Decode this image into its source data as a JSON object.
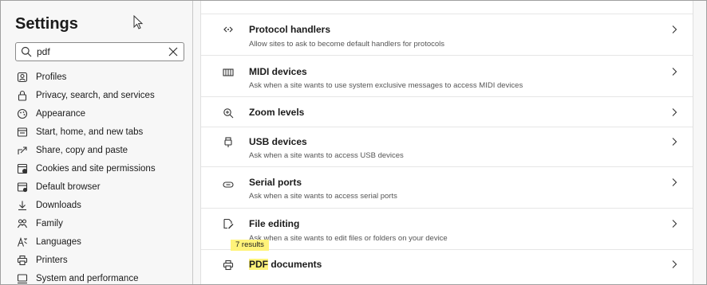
{
  "sidebar": {
    "title": "Settings",
    "search": {
      "value": "pdf",
      "placeholder": ""
    },
    "items": [
      {
        "label": "Profiles",
        "icon": "profile-icon"
      },
      {
        "label": "Privacy, search, and services",
        "icon": "lock-icon"
      },
      {
        "label": "Appearance",
        "icon": "appearance-icon"
      },
      {
        "label": "Start, home, and new tabs",
        "icon": "home-tabs-icon"
      },
      {
        "label": "Share, copy and paste",
        "icon": "share-icon"
      },
      {
        "label": "Cookies and site permissions",
        "icon": "cookies-icon"
      },
      {
        "label": "Default browser",
        "icon": "browser-icon"
      },
      {
        "label": "Downloads",
        "icon": "download-icon"
      },
      {
        "label": "Family",
        "icon": "family-icon"
      },
      {
        "label": "Languages",
        "icon": "languages-icon"
      },
      {
        "label": "Printers",
        "icon": "printer-icon"
      },
      {
        "label": "System and performance",
        "icon": "system-icon"
      }
    ]
  },
  "main": {
    "rows": [
      {
        "title": "Protocol handlers",
        "desc": "Allow sites to ask to become default handlers for protocols",
        "icon": "protocol-icon"
      },
      {
        "title": "MIDI devices",
        "desc": "Ask when a site wants to use system exclusive messages to access MIDI devices",
        "icon": "midi-icon"
      },
      {
        "title": "Zoom levels",
        "desc": "",
        "icon": "zoom-icon"
      },
      {
        "title": "USB devices",
        "desc": "Ask when a site wants to access USB devices",
        "icon": "usb-icon"
      },
      {
        "title": "Serial ports",
        "desc": "Ask when a site wants to access serial ports",
        "icon": "serial-icon"
      },
      {
        "title": "File editing",
        "desc": "Ask when a site wants to edit files or folders on your device",
        "icon": "file-edit-icon"
      },
      {
        "title_highlight": "PDF",
        "title_rest": " documents",
        "icon": "pdf-icon"
      }
    ],
    "results_tooltip": "7 results"
  },
  "colors": {
    "highlight": "#fff37a",
    "background": "#f7f7f7"
  }
}
